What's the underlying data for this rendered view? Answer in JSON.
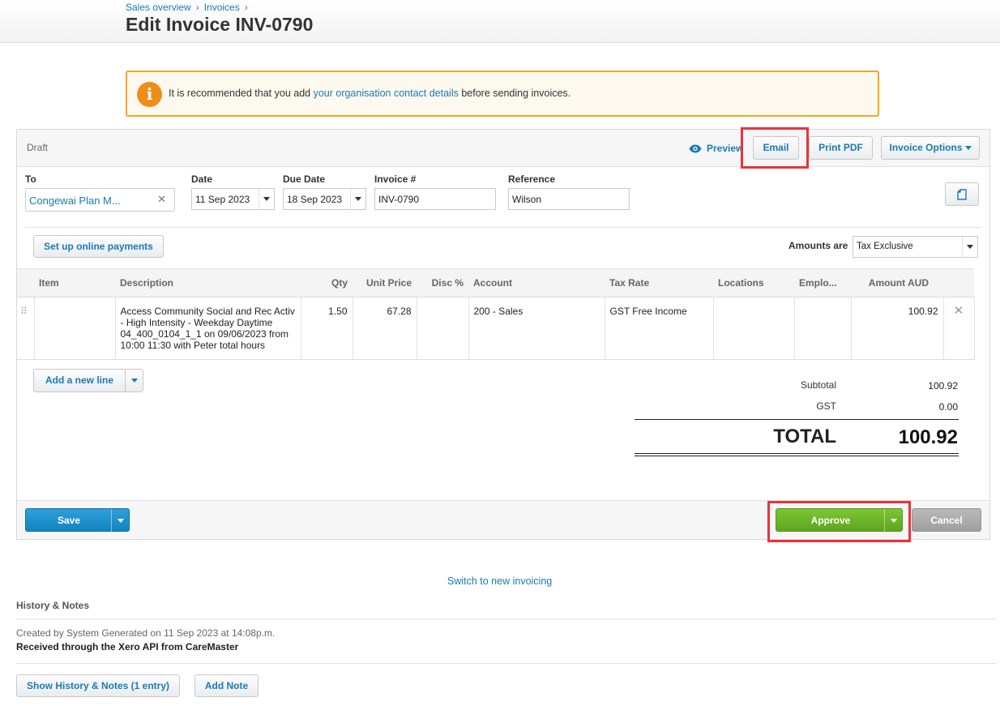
{
  "breadcrumb": {
    "items": [
      "Sales overview",
      "Invoices"
    ],
    "separator": "›"
  },
  "page_title": "Edit Invoice INV-0790",
  "alert": {
    "icon": "info-icon",
    "text_before": "It is recommended that you add ",
    "link": "your organisation contact details",
    "text_after": " before sending invoices."
  },
  "toolbar": {
    "status": "Draft",
    "preview_label": "Preview",
    "email_label": "Email",
    "print_pdf_label": "Print PDF",
    "invoice_options_label": "Invoice Options"
  },
  "form": {
    "to_label": "To",
    "to_value": "Congewai Plan M...",
    "date_label": "Date",
    "date_value": "11 Sep 2023",
    "due_date_label": "Due Date",
    "due_date_value": "18 Sep 2023",
    "invoice_no_label": "Invoice #",
    "invoice_no_value": "INV-0790",
    "reference_label": "Reference",
    "reference_value": "Wilson"
  },
  "online_payments_label": "Set up online payments",
  "amounts": {
    "label": "Amounts are",
    "value": "Tax Exclusive"
  },
  "table": {
    "columns": [
      "Item",
      "Description",
      "Qty",
      "Unit Price",
      "Disc %",
      "Account",
      "Tax Rate",
      "Locations",
      "Emplo...",
      "Amount AUD"
    ],
    "rows": [
      {
        "item": "",
        "description": "Access Community Social and Rec Activ - High Intensity - Weekday Daytime 04_400_0104_1_1 on 09/06/2023 from 10:00 11:30 with Peter total hours",
        "qty": "1.50",
        "unit_price": "67.28",
        "disc": "",
        "account": "200 - Sales",
        "tax_rate": "GST Free Income",
        "locations": "",
        "employee": "",
        "amount": "100.92"
      }
    ]
  },
  "add_line_label": "Add a new line",
  "totals": {
    "subtotal_label": "Subtotal",
    "subtotal_value": "100.92",
    "gst_label": "GST",
    "gst_value": "0.00",
    "total_label": "TOTAL",
    "total_value": "100.92"
  },
  "footer": {
    "save_label": "Save",
    "approve_label": "Approve",
    "cancel_label": "Cancel"
  },
  "switch_link": "Switch to new invoicing",
  "history": {
    "title": "History & Notes",
    "created": "Created by System Generated on 11 Sep 2023 at 14:08p.m.",
    "received": "Received through the Xero API from CareMaster",
    "show_label": "Show History & Notes (1 entry)",
    "add_note_label": "Add Note"
  },
  "colors": {
    "link": "#1a7ab5",
    "save_blue": "#1b8ac7",
    "approve_green": "#6cb52a",
    "cancel_grey": "#a8a8a8",
    "alert_border": "#f5a623",
    "highlight_red": "#e8343c"
  }
}
